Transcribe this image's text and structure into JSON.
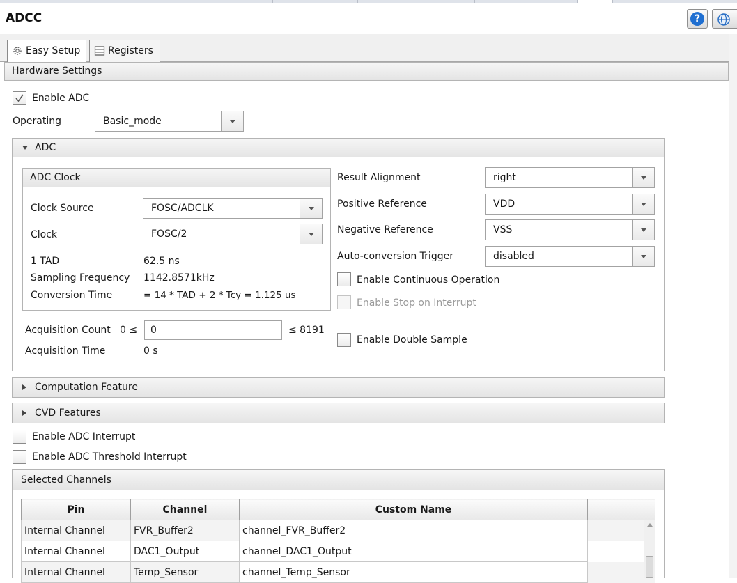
{
  "window": {
    "title": "ADCC"
  },
  "tabs": [
    {
      "label": "Easy Setup",
      "icon": "gear-icon",
      "active": true
    },
    {
      "label": "Registers",
      "icon": "list-icon",
      "active": false
    }
  ],
  "hardware_settings": {
    "header": "Hardware Settings",
    "enable_adc": {
      "label": "Enable ADC",
      "checked": true
    },
    "operating": {
      "label": "Operating",
      "value": "Basic_mode"
    }
  },
  "adc": {
    "header": "ADC",
    "clock_group": {
      "header": "ADC Clock",
      "clock_source": {
        "label": "Clock Source",
        "value": "FOSC/ADCLK"
      },
      "clock": {
        "label": "Clock",
        "value": "FOSC/2"
      },
      "tad": {
        "label": "1 TAD",
        "value": "62.5 ns"
      },
      "sampling_frequency": {
        "label": "Sampling Frequency",
        "value": "1142.8571kHz"
      },
      "conversion_time": {
        "label": "Conversion Time",
        "value": "= 14 * TAD + 2 * Tcy = 1.125 us"
      }
    },
    "acquisition_count": {
      "label": "Acquisition Count",
      "min_text": "0 ≤",
      "value": "0",
      "max_text": "≤ 8191"
    },
    "acquisition_time": {
      "label": "Acquisition Time",
      "value": "0 s"
    },
    "result_alignment": {
      "label": "Result Alignment",
      "value": "right"
    },
    "positive_reference": {
      "label": "Positive Reference",
      "value": "VDD"
    },
    "negative_reference": {
      "label": "Negative Reference",
      "value": "VSS"
    },
    "auto_conversion_trigger": {
      "label": "Auto-conversion Trigger",
      "value": "disabled"
    },
    "enable_continuous": {
      "label": "Enable Continuous Operation",
      "checked": false
    },
    "enable_stop_on_interrupt": {
      "label": "Enable Stop on Interrupt",
      "checked": false,
      "disabled": true
    },
    "enable_double_sample": {
      "label": "Enable Double Sample",
      "checked": false
    }
  },
  "computation_feature": {
    "header": "Computation Feature"
  },
  "cvd_features": {
    "header": "CVD Features"
  },
  "enable_adc_interrupt": {
    "label": "Enable ADC Interrupt",
    "checked": false
  },
  "enable_adc_threshold_interrupt": {
    "label": "Enable ADC Threshold Interrupt",
    "checked": false
  },
  "selected_channels": {
    "header": "Selected Channels",
    "columns": [
      "Pin",
      "Channel",
      "Custom Name",
      ""
    ],
    "rows": [
      {
        "pin": "Internal Channel",
        "channel": "FVR_Buffer2",
        "custom_name": "channel_FVR_Buffer2"
      },
      {
        "pin": "Internal Channel",
        "channel": "DAC1_Output",
        "custom_name": "channel_DAC1_Output"
      },
      {
        "pin": "Internal Channel",
        "channel": "Temp_Sensor",
        "custom_name": "channel_Temp_Sensor"
      }
    ]
  }
}
